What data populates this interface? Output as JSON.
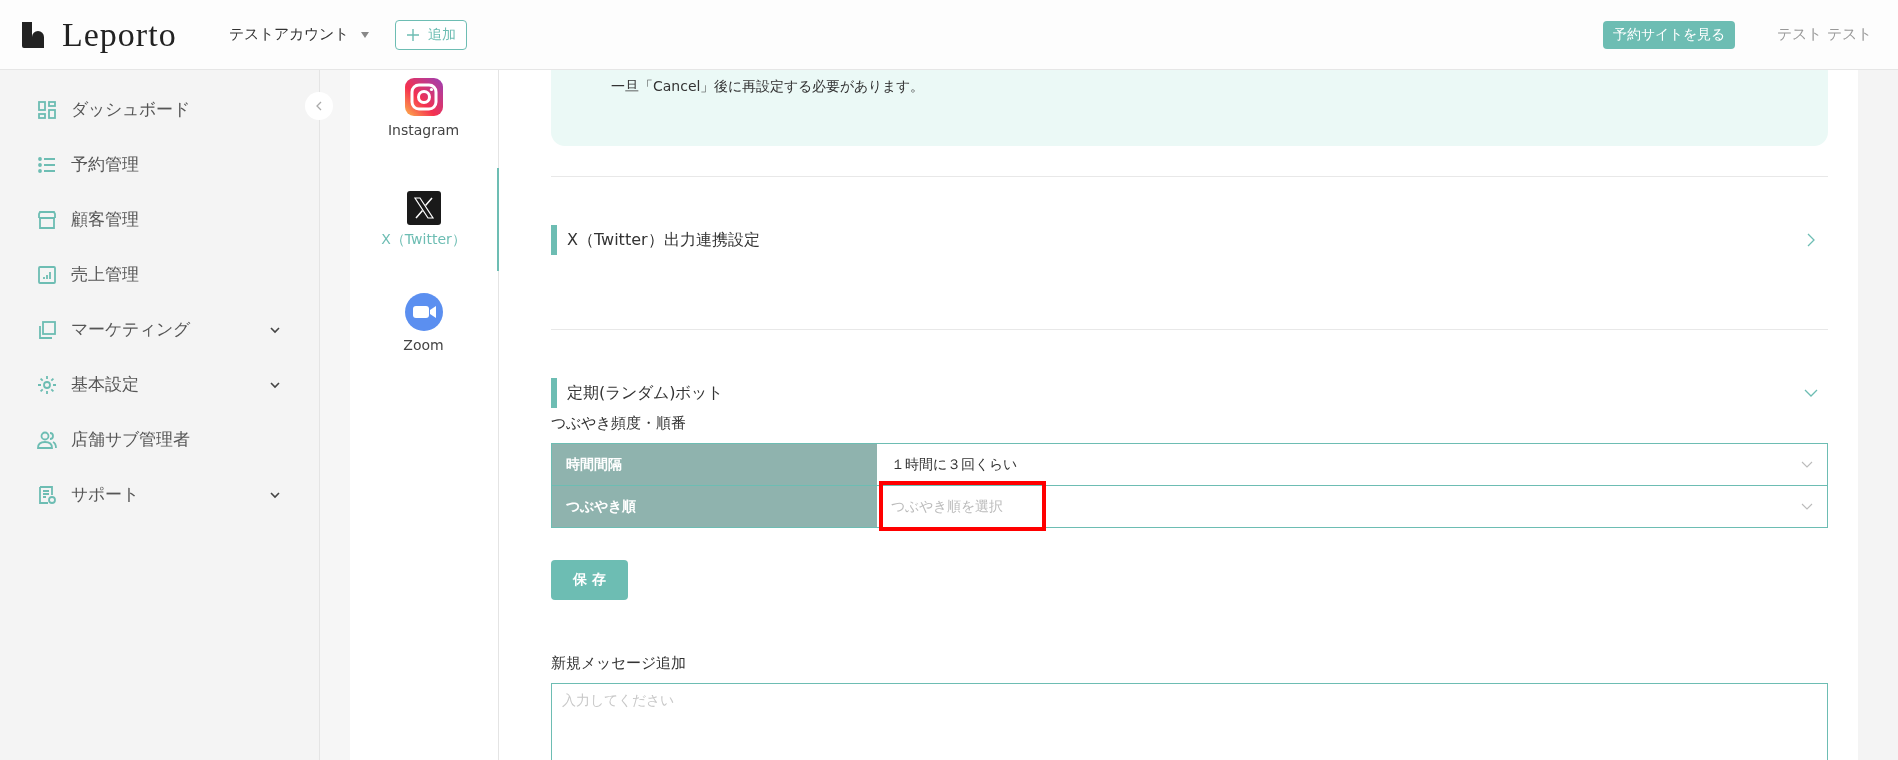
{
  "header": {
    "logo": "Leporto",
    "account": "テストアカウント",
    "add_button": "追加",
    "site_button": "予約サイトを見る",
    "user": "テスト テスト"
  },
  "sidebar": {
    "items": [
      {
        "kind": "dashboard",
        "label": "ダッシュボード",
        "expandable": false
      },
      {
        "kind": "list",
        "label": "予約管理",
        "expandable": false
      },
      {
        "kind": "store",
        "label": "顧客管理",
        "expandable": false
      },
      {
        "kind": "chart",
        "label": "売上管理",
        "expandable": false
      },
      {
        "kind": "copy",
        "label": "マーケティング",
        "expandable": true
      },
      {
        "kind": "gear",
        "label": "基本設定",
        "expandable": true
      },
      {
        "kind": "people",
        "label": "店舗サブ管理者",
        "expandable": false
      },
      {
        "kind": "doc",
        "label": "サポート",
        "expandable": true
      }
    ]
  },
  "sns_nav": [
    {
      "kind": "instagram",
      "label": "Instagram",
      "selected": false
    },
    {
      "kind": "x",
      "label": "X（Twitter）",
      "selected": true
    },
    {
      "kind": "zoom",
      "label": "Zoom",
      "selected": false
    }
  ],
  "notice": {
    "text": "一旦「Cancel」後に再設定する必要があります。"
  },
  "sections": [
    {
      "title": "X（Twitter）出力連携設定",
      "expanded": false
    },
    {
      "title": "定期(ランダム)ボット",
      "expanded": true
    }
  ],
  "frequency": {
    "heading": "つぶやき頻度・順番",
    "rows": [
      {
        "label": "時間間隔",
        "value": "１時間に３回くらい",
        "highlighted": false
      },
      {
        "label": "つぶやき順",
        "placeholder": "つぶやき順を選択",
        "highlighted": true
      }
    ],
    "save_button": "保 存"
  },
  "new_message": {
    "heading": "新規メッセージ追加",
    "placeholder": "入力してください"
  }
}
